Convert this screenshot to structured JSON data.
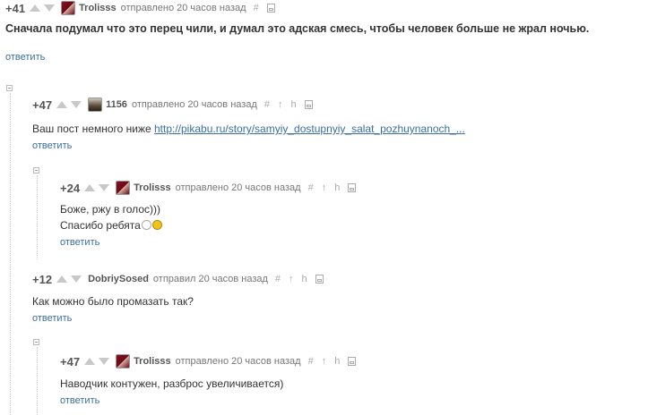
{
  "comments": [
    {
      "rating": "+41",
      "author": "Trolisss",
      "time": "отправлено 20 часов назад",
      "text": "Сначала подумал что это перец чили, и думал это адская смесь, чтобы человек больше не жрал ночью.",
      "reply": "ответить"
    },
    {
      "rating": "+47",
      "author": "1156",
      "time": "отправлено 20 часов назад",
      "text": "Ваш пост немного ниже ",
      "link": "http://pikabu.ru/story/samyiy_dostupnyiy_salat_pozhuynanoch_...",
      "reply": "ответить"
    },
    {
      "rating": "+24",
      "author": "Trolisss",
      "time": "отправлено 20 часов назад",
      "line1": "Боже, ржу в голос)))",
      "line2": "Спасибо ребята",
      "reply": "ответить"
    },
    {
      "rating": "+12",
      "author": "DobriySosed",
      "time": "отправил 20 часов назад",
      "text": "Как можно было промазать так?",
      "reply": "ответить"
    },
    {
      "rating": "+47",
      "author": "Trolisss",
      "time": "отправлено 20 часов назад",
      "text": "Наводчик контужен, разброс увеличивается)",
      "reply": "ответить"
    }
  ],
  "icons": {
    "link": "#",
    "parent": "↑",
    "thread": "h",
    "save": "save-icon"
  },
  "colors": {
    "link": "#3a6ea5",
    "rating": "#555555",
    "vote": "#c8c8c8"
  }
}
